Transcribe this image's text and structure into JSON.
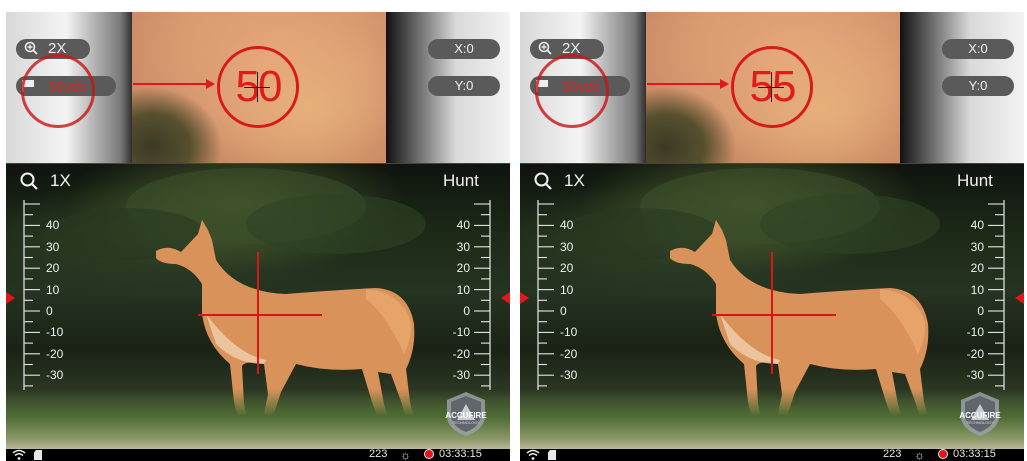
{
  "panels": [
    {
      "zoom": "2X",
      "distance": "50yds",
      "distance_number": "50",
      "x_offset": "X:0",
      "y_offset": "Y:0",
      "magnification": "1X",
      "mode": "Hunt",
      "ruler_labels": [
        "40",
        "30",
        "20",
        "10",
        "0",
        "-10",
        "-20",
        "-30"
      ],
      "status": {
        "count": "223",
        "time": "03:33:15"
      },
      "logo": {
        "name": "ACCUFIRE",
        "sub": "TECHNOLOGY"
      }
    },
    {
      "zoom": "2X",
      "distance": "55yds",
      "distance_number": "55",
      "x_offset": "X:0",
      "y_offset": "Y:0",
      "magnification": "1X",
      "mode": "Hunt",
      "ruler_labels": [
        "40",
        "30",
        "20",
        "10",
        "0",
        "-10",
        "-20",
        "-30"
      ],
      "status": {
        "count": "223",
        "time": "03:33:15"
      },
      "logo": {
        "name": "ACCUFIRE",
        "sub": "TECHNOLOGY"
      }
    }
  ],
  "icons": {
    "zoom": "zoom-in-icon",
    "distance": "flag-icon",
    "magnification": "search-icon",
    "wifi": "wifi-icon",
    "storage": "sd-card-icon",
    "brightness": "sun-icon",
    "record": "record-icon"
  },
  "colors": {
    "reticle": "#d21818",
    "accent": "#e4161b",
    "pill": "#5a5a5a"
  }
}
